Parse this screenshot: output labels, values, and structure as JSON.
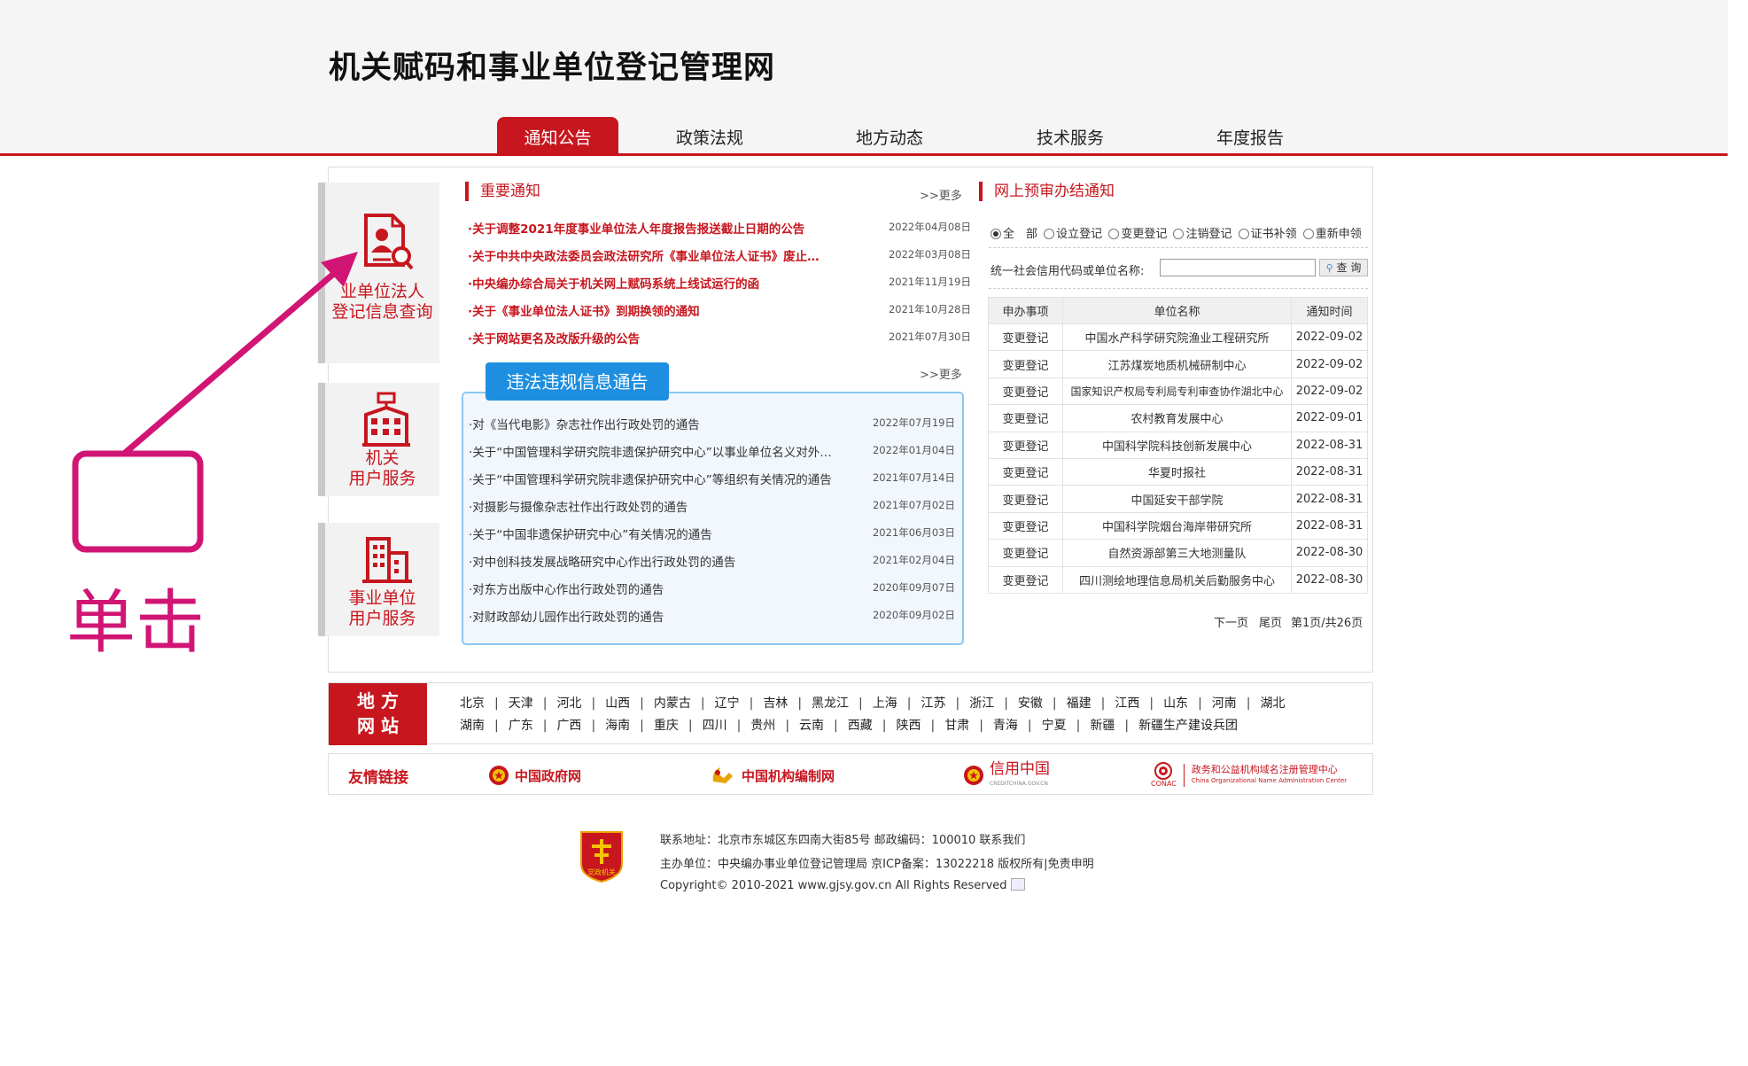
{
  "site": {
    "title": "机关赋码和事业单位登记管理网"
  },
  "nav": {
    "items": [
      {
        "label": "通知公告",
        "active": true
      },
      {
        "label": "政策法规",
        "active": false
      },
      {
        "label": "地方动态",
        "active": false
      },
      {
        "label": "技术服务",
        "active": false
      },
      {
        "label": "年度报告",
        "active": false
      }
    ]
  },
  "sidebar": {
    "cards": [
      {
        "label_line1": "业单位法人",
        "label_line2": "登记信息查询",
        "icon": "person-search-icon"
      },
      {
        "label_line1": "机关",
        "label_line2": "用户服务",
        "icon": "government-building-icon"
      },
      {
        "label_line1": "事业单位",
        "label_line2": "用户服务",
        "icon": "office-building-icon"
      }
    ]
  },
  "important_notices": {
    "heading": "重要通知",
    "more": ">>更多",
    "items": [
      {
        "title": "·关于调整2021年度事业单位法人年度报告报送截止日期的公告",
        "date": "2022年04月08日"
      },
      {
        "title": "·关于中共中央政法委员会政法研究所《事业单位法人证书》废止…",
        "date": "2022年03月08日"
      },
      {
        "title": "·中央编办综合局关于机关网上赋码系统上线试运行的函",
        "date": "2021年11月19日"
      },
      {
        "title": "·关于《事业单位法人证书》到期换领的通知",
        "date": "2021年10月28日"
      },
      {
        "title": "·关于网站更名及改版升级的公告",
        "date": "2021年07月30日"
      }
    ]
  },
  "violations": {
    "heading": "违法违规信息通告",
    "more": ">>更多",
    "items": [
      {
        "title": "·对《当代电影》杂志社作出行政处罚的通告",
        "date": "2022年07月19日"
      },
      {
        "title": "·关于“中国管理科学研究院非遗保护研究中心”以事业单位名义对外…",
        "date": "2022年01月04日"
      },
      {
        "title": "·关于“中国管理科学研究院非遗保护研究中心”等组织有关情况的通告",
        "date": "2021年07月14日"
      },
      {
        "title": "·对摄影与摄像杂志社作出行政处罚的通告",
        "date": "2021年07月02日"
      },
      {
        "title": "·关于“中国非遗保护研究中心”有关情况的通告",
        "date": "2021年06月03日"
      },
      {
        "title": "·对中创科技发展战略研究中心作出行政处罚的通告",
        "date": "2021年02月04日"
      },
      {
        "title": "·对东方出版中心作出行政处罚的通告",
        "date": "2020年09月07日"
      },
      {
        "title": "·对财政部幼儿园作出行政处罚的通告",
        "date": "2020年09月02日"
      }
    ]
  },
  "online_review": {
    "heading": "网上预审办结通知",
    "radios": [
      {
        "label": "全　部",
        "checked": true
      },
      {
        "label": "设立登记",
        "checked": false
      },
      {
        "label": "变更登记",
        "checked": false
      },
      {
        "label": "注销登记",
        "checked": false
      },
      {
        "label": "证书补领",
        "checked": false
      },
      {
        "label": "重新申领",
        "checked": false
      }
    ],
    "query_label": "统一社会信用代码或单位名称:",
    "query_value": "",
    "query_button": "查 询",
    "columns": [
      "申办事项",
      "单位名称",
      "通知时间"
    ],
    "rows": [
      [
        "变更登记",
        "中国水产科学研究院渔业工程研究所",
        "2022-09-02"
      ],
      [
        "变更登记",
        "江苏煤炭地质机械研制中心",
        "2022-09-02"
      ],
      [
        "变更登记",
        "国家知识产权局专利局专利审查协作湖北中心",
        "2022-09-02"
      ],
      [
        "变更登记",
        "农村教育发展中心",
        "2022-09-01"
      ],
      [
        "变更登记",
        "中国科学院科技创新发展中心",
        "2022-08-31"
      ],
      [
        "变更登记",
        "华夏时报社",
        "2022-08-31"
      ],
      [
        "变更登记",
        "中国延安干部学院",
        "2022-08-31"
      ],
      [
        "变更登记",
        "中国科学院烟台海岸带研究所",
        "2022-08-31"
      ],
      [
        "变更登记",
        "自然资源部第三大地测量队",
        "2022-08-30"
      ],
      [
        "变更登记",
        "四川测绘地理信息局机关后勤服务中心",
        "2022-08-30"
      ]
    ],
    "pager": {
      "next": "下一页",
      "last": "尾页",
      "info": "第1页/共26页"
    }
  },
  "local_sites": {
    "label_line1": "地 方",
    "label_line2": "网 站",
    "row1": [
      "北京",
      "天津",
      "河北",
      "山西",
      "内蒙古",
      "辽宁",
      "吉林",
      "黑龙江",
      "上海",
      "江苏",
      "浙江",
      "安徽",
      "福建",
      "江西",
      "山东",
      "河南",
      "湖北"
    ],
    "row2": [
      "湖南",
      "广东",
      "广西",
      "海南",
      "重庆",
      "四川",
      "贵州",
      "云南",
      "西藏",
      "陕西",
      "甘肃",
      "青海",
      "宁夏",
      "新疆",
      "新疆生产建设兵团"
    ]
  },
  "friend_links": {
    "label": "友情链接",
    "items": [
      {
        "name": "中国政府网",
        "icon": "national-emblem-icon"
      },
      {
        "name": "中国机构编制网",
        "icon": "party-emblem-icon"
      },
      {
        "name": "信用中国",
        "sub": "CREDITCHINA.GOV.CN",
        "icon": "national-emblem-icon"
      },
      {
        "name": "政务和公益机构域名注册管理中心",
        "sub": "China Organizational Name Administration Center",
        "tag": "CONAC",
        "icon": "conac-logo-icon"
      }
    ]
  },
  "footer": {
    "emblem_text": "党政机关",
    "address": "联系地址：北京市东城区东四南大街85号 邮政编码：100010 联系我们",
    "organizer": "主办单位：中央编办事业单位登记管理局 京ICP备案：13022218 版权所有|免责申明",
    "copyright": "Copyright© 2010-2021 www.gjsy.gov.cn All Rights Reserved"
  },
  "annotation": {
    "text": "单击",
    "color": "#d11575"
  },
  "colors": {
    "brand_red": "#c7161e",
    "violation_blue": "#1e8fe0",
    "link_blue": "#1a5fb4"
  }
}
